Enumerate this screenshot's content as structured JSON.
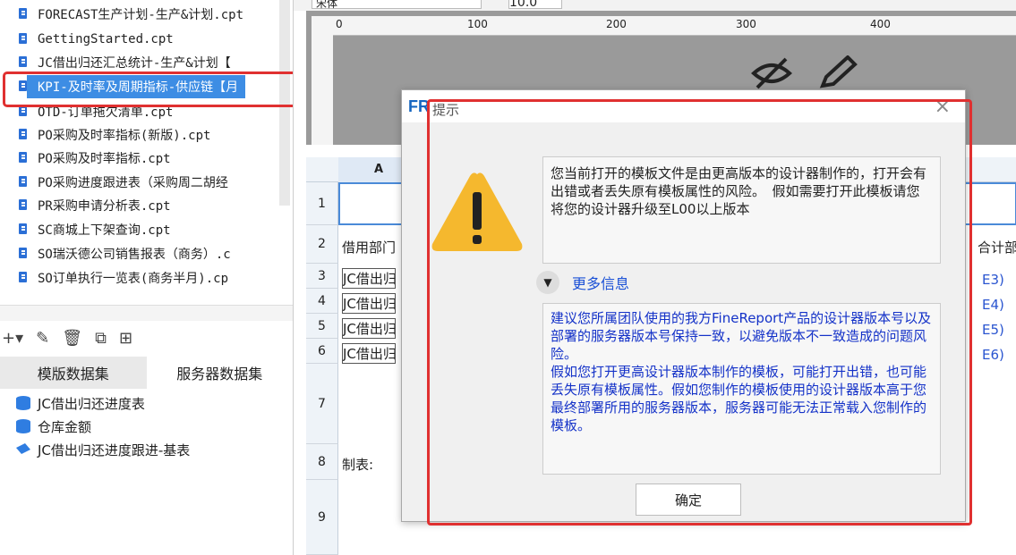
{
  "file_tree": {
    "files": [
      {
        "name": "FORECAST生产计划-生产&计划.cpt",
        "selected": false
      },
      {
        "name": "GettingStarted.cpt",
        "selected": false
      },
      {
        "name": "JC借出归还汇总统计-生产&计划【",
        "selected": false
      },
      {
        "name": "KPI-及时率及周期指标-供应链【月",
        "selected": true
      },
      {
        "name": "OTD-订单拖欠清单.cpt",
        "selected": false
      },
      {
        "name": "PO采购及时率指标(新版).cpt",
        "selected": false
      },
      {
        "name": "PO采购及时率指标.cpt",
        "selected": false
      },
      {
        "name": "PO采购进度跟进表（采购周二胡经",
        "selected": false
      },
      {
        "name": "PR采购申请分析表.cpt",
        "selected": false
      },
      {
        "name": "SC商城上下架查询.cpt",
        "selected": false
      },
      {
        "name": "SO瑞沃德公司销售报表（商务）.c",
        "selected": false
      },
      {
        "name": "SO订单执行一览表(商务半月).cp",
        "selected": false
      }
    ]
  },
  "dataset_tabs": [
    {
      "label": "模版数据集",
      "active": true
    },
    {
      "label": "服务器数据集",
      "active": false
    }
  ],
  "datasets": [
    {
      "name": "JC借出归还进度表",
      "icon": "database-icon"
    },
    {
      "name": "仓库金额",
      "icon": "database-icon"
    },
    {
      "name": "JC借出归还进度跟进-基表",
      "icon": "dataset-link-icon"
    }
  ],
  "toolbar": {
    "font": "宋体",
    "size": "10.0"
  },
  "ruler": {
    "ticks": [
      "0",
      "100",
      "200",
      "300",
      "400"
    ]
  },
  "grid": {
    "column_a": "A",
    "rows": [
      "1",
      "2",
      "3",
      "4",
      "5",
      "6",
      "7",
      "8",
      "9"
    ],
    "header_cell": "借用部门",
    "data_cells": [
      "JC借出归",
      "JC借出归",
      "JC借出归",
      "JC借出归"
    ],
    "footer_cell": "制表:",
    "right_header": "合计",
    "right_header2": "部",
    "right_cells": [
      "E3)",
      "E4)",
      "E5)",
      "E6)"
    ]
  },
  "dialog": {
    "logo": "FR",
    "title": "提示",
    "message": "您当前打开的模板文件是由更高版本的设计器制作的，打开会有出错或者丢失原有模板属性的风险。　假如需要打开此模板请您将您的设计器升级至L00以上版本",
    "more_info_label": "更多信息",
    "detail": "建议您所属团队使用的我方FineReport产品的设计器版本号以及部署的服务器版本号保持一致，以避免版本不一致造成的问题风险。\n假如您打开更高设计器版本制作的模板，可能打开出错，也可能丢失原有模板属性。假如您制作的模板使用的设计器版本高于您最终部署所用的服务器版本，服务器可能无法正常载入您制作的模板。",
    "ok_label": "确定"
  },
  "colors": {
    "accent": "#3d8de4",
    "highlight": "#e03030",
    "link": "#1432c8",
    "warning": "#f5b82e"
  }
}
